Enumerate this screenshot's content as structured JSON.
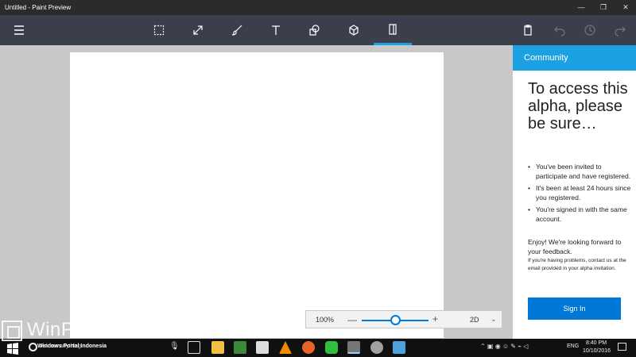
{
  "window": {
    "title": "Untitled - Paint Preview",
    "controls": [
      "minimize-icon",
      "maximize-icon",
      "close-icon"
    ]
  },
  "toolbar": {
    "menu_icon": "hamburger-icon",
    "tools": [
      {
        "name": "select",
        "icon": "marquee-select-icon"
      },
      {
        "name": "crop",
        "icon": "crop-resize-icon"
      },
      {
        "name": "brushes",
        "icon": "brush-icon"
      },
      {
        "name": "text",
        "icon": "text-icon"
      },
      {
        "name": "2d-shapes",
        "icon": "shapes-icon"
      },
      {
        "name": "3d-objects",
        "icon": "cube-icon"
      },
      {
        "name": "canvas",
        "icon": "canvas-icon",
        "active": true
      }
    ],
    "right_icons": [
      "paste-icon",
      "undo-icon",
      "history-icon",
      "redo-icon"
    ],
    "accent": "#1ba1e2"
  },
  "zoom": {
    "percent_label": "100%",
    "value": 0.5,
    "mode_label": "2D"
  },
  "panel": {
    "header": "Community",
    "headline": "To access this alpha, please be sure…",
    "bullets": [
      "You've been invited to participate and have registered.",
      "It's been at least 24 hours since you registered.",
      "You're signed in with the same account."
    ],
    "enjoy": "Enjoy! We're looking forward to your feedback.",
    "help": "If you're having problems, contact us at the email provided in your alpha invitation.",
    "signin_label": "Sign In",
    "button_color": "#0078d7"
  },
  "taskbar": {
    "search_placeholder": "Ask me anything",
    "apps": [
      "task-view-icon",
      "file-explorer-icon",
      "app-icon",
      "store-icon",
      "vlc-icon",
      "firefox-icon",
      "line-icon",
      "paint-icon",
      "app-icon-2",
      "app-icon-3"
    ],
    "language": "ENG",
    "time": "8:40 PM",
    "date": "10/10/2016"
  },
  "watermark": {
    "brand": "WinPoin",
    "sub": "Windows Portal Indonesia"
  }
}
